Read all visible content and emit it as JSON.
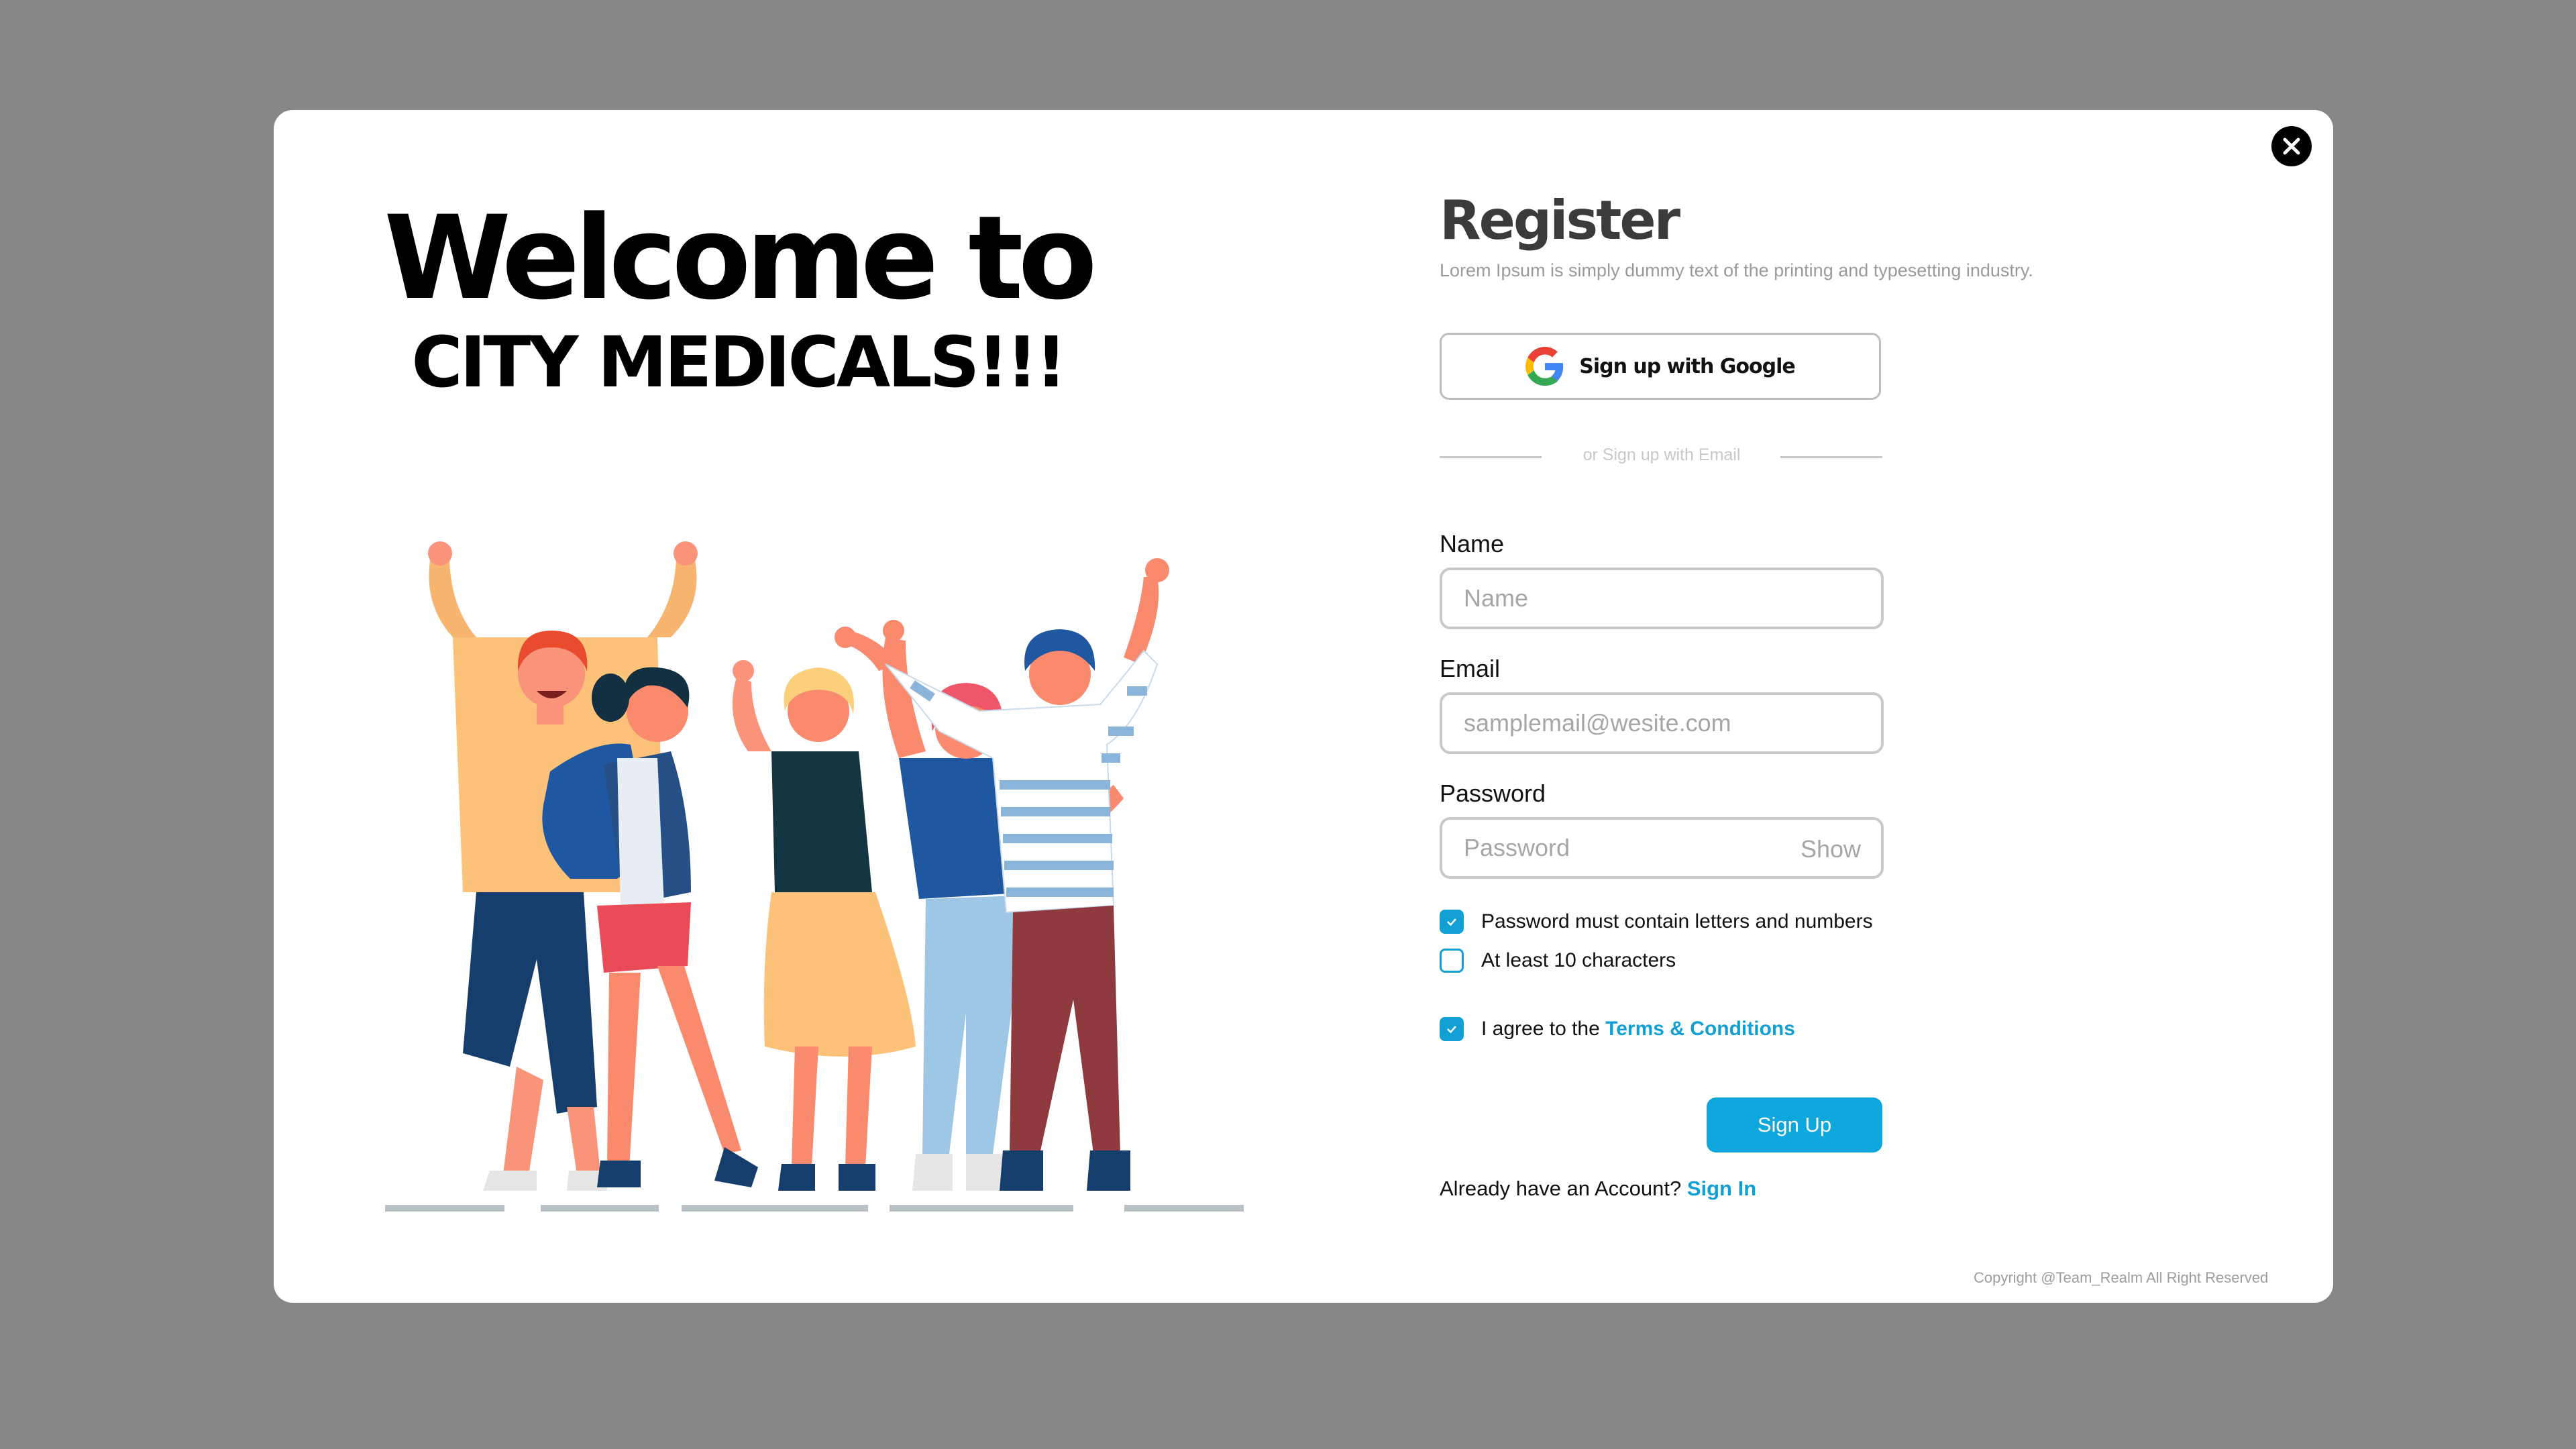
{
  "welcome": {
    "line1": "Welcome to",
    "line2": "CITY MEDICALS!!!"
  },
  "register": {
    "title": "Register",
    "subtitle": "Lorem Ipsum is simply dummy text of the printing and typesetting industry.",
    "google_label": "Sign up with Google",
    "divider_text": "or Sign up with Email"
  },
  "form": {
    "name_label": "Name",
    "name_placeholder": "Name",
    "email_label": "Email",
    "email_placeholder": "samplemail@wesite.com",
    "password_label": "Password",
    "password_placeholder": "Password",
    "show_label": "Show"
  },
  "checks": [
    {
      "label": "Password must contain letters and numbers",
      "checked": true
    },
    {
      "label": "At least 10 characters",
      "checked": false
    }
  ],
  "terms": {
    "prefix": "I agree to the ",
    "link": "Terms & Conditions",
    "checked": true
  },
  "signup_label": "Sign Up",
  "signin": {
    "prefix": "Already have an Account? ",
    "link": "Sign In"
  },
  "copyright": "Copyright @Team_Realm All Right Reserved",
  "colors": {
    "accent": "#0ea7dd",
    "backdrop": "#878787"
  },
  "icons": {
    "close": "close-icon",
    "google": "google-icon",
    "check": "check-icon"
  }
}
